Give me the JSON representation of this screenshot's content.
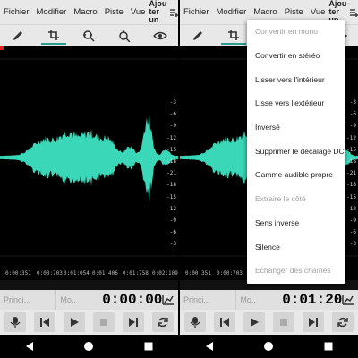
{
  "menu": {
    "fichier": "Fichier",
    "modifier": "Modifier",
    "macro": "Macro",
    "piste": "Piste",
    "vue": "Vue",
    "ajouter_line1": "Ajou-",
    "ajouter_line2": "ter un"
  },
  "db_scale": [
    "-3",
    "-6",
    "-9",
    "-12",
    "-15",
    "-18",
    "-21",
    "-18",
    "-15",
    "-12",
    "-9",
    "-6",
    "-3"
  ],
  "left": {
    "time_ticks": [
      "0:00:351",
      "0:00:703",
      "0:01:054",
      "0:01:406",
      "0:01:758",
      "0:02:109"
    ],
    "status": {
      "selector1": "Princi...",
      "selector2": "Mo..",
      "time": "0:00:00"
    }
  },
  "right": {
    "time_ticks": [
      "0:00:351",
      "0:00:703"
    ],
    "status": {
      "selector1": "Princi...",
      "selector2": "Mo..",
      "time": "0:01:20"
    }
  },
  "dropdown": {
    "items": [
      {
        "label": "Convertir en mono",
        "enabled": false
      },
      {
        "label": "Convertir en stéréo",
        "enabled": true
      },
      {
        "label": "Lisser vers l'intérieur",
        "enabled": true
      },
      {
        "label": "Lisse vers l'extérieur",
        "enabled": true
      },
      {
        "label": "Inversé",
        "enabled": true
      },
      {
        "label": "Supprimer le décalage DC",
        "enabled": true
      },
      {
        "label": "Gamme audible propre",
        "enabled": true
      },
      {
        "label": "Extraire le côté",
        "enabled": false
      },
      {
        "label": "Sens inverse",
        "enabled": true
      },
      {
        "label": "Silence",
        "enabled": true
      },
      {
        "label": "Echanger des chaînes",
        "enabled": false
      }
    ]
  },
  "colors": {
    "waveform": "#3ad8b8",
    "accent": "#2a9d8f",
    "playhead": "#e02020"
  },
  "icons": {
    "toolbar": [
      "pencil-icon",
      "crop-icon",
      "zoom-fit-icon",
      "zoom-icon",
      "eye-icon"
    ],
    "transport": [
      "microphone-icon",
      "skip-back-icon",
      "play-icon",
      "stop-icon",
      "skip-forward-icon",
      "loop-icon"
    ],
    "nav": [
      "back-icon",
      "home-icon",
      "recents-icon"
    ]
  }
}
